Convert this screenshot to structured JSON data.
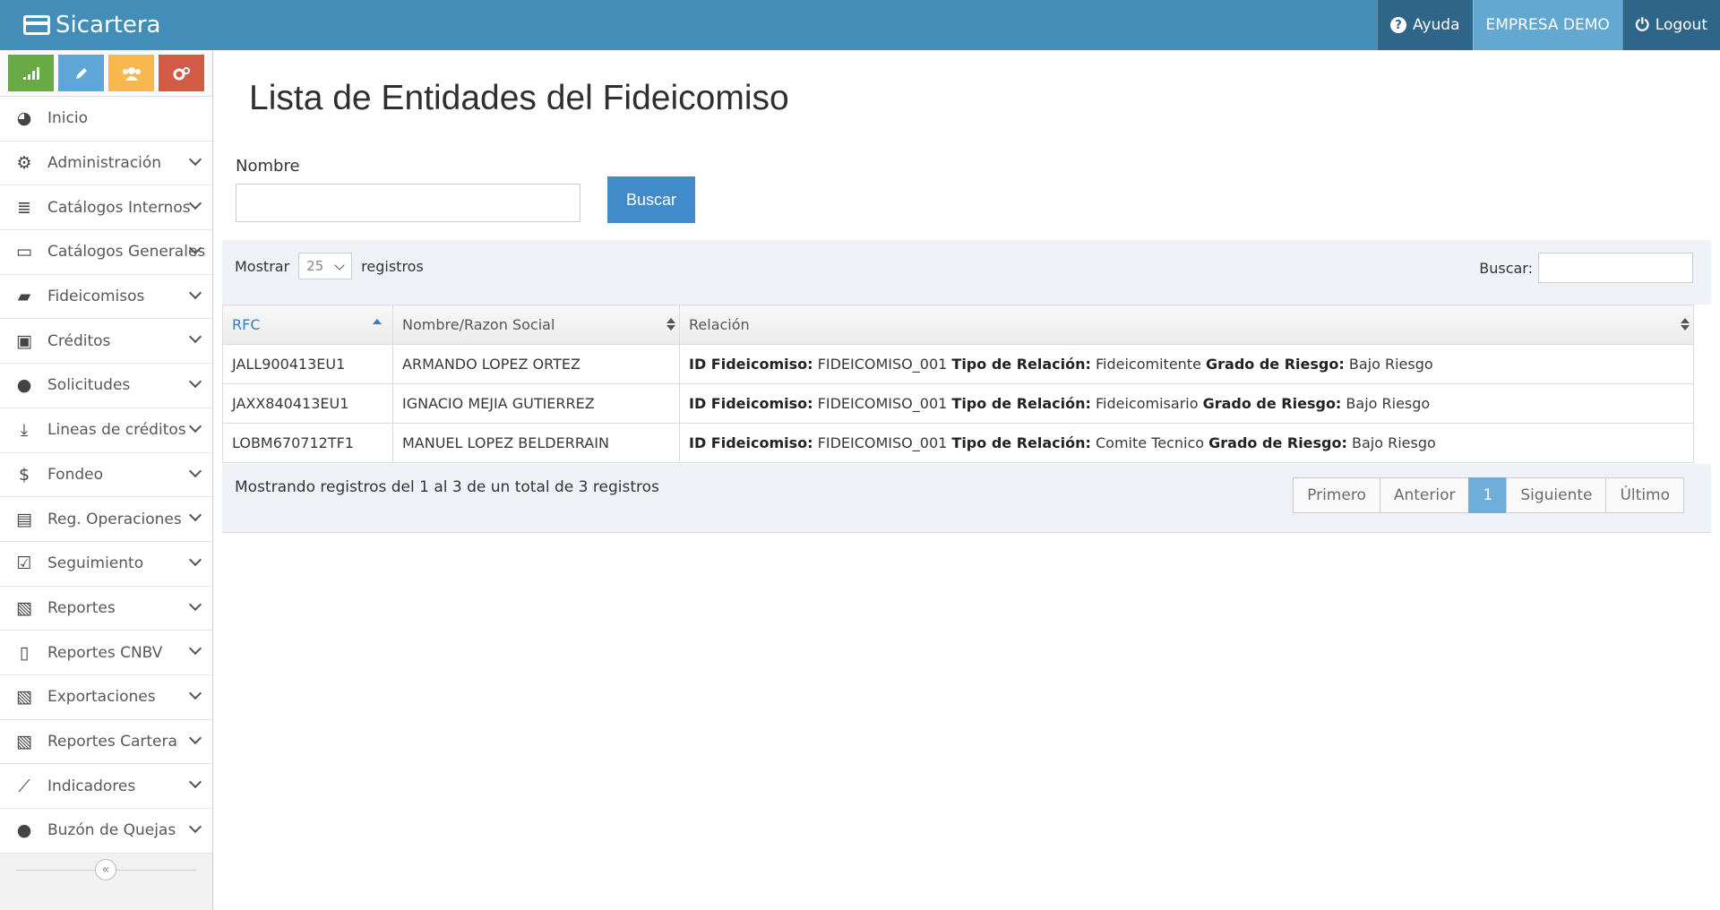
{
  "navbar": {
    "brand": "Sicartera",
    "help_label": "Ayuda",
    "company_label": "EMPRESA DEMO",
    "logout_label": "Logout"
  },
  "sidebar": {
    "shortcuts": [
      {
        "icon": "signal-icon",
        "color": "#69aa46"
      },
      {
        "icon": "pencil-icon",
        "color": "#5ea5d8"
      },
      {
        "icon": "users-icon",
        "color": "#f8b84e"
      },
      {
        "icon": "cogs-icon",
        "color": "#d15b47"
      }
    ],
    "items": [
      {
        "label": "Inicio",
        "icon": "dashboard-icon"
      },
      {
        "label": "Administración",
        "icon": "cogs-icon"
      },
      {
        "label": "Catálogos Internos",
        "icon": "database-icon"
      },
      {
        "label": "Catálogos Generales",
        "icon": "desktop-icon"
      },
      {
        "label": "Fideicomisos",
        "icon": "folder-open-icon"
      },
      {
        "label": "Créditos",
        "icon": "briefcase-icon"
      },
      {
        "label": "Solicitudes",
        "icon": "user-icon"
      },
      {
        "label": "Lineas de créditos",
        "icon": "download-icon"
      },
      {
        "label": "Fondeo",
        "icon": "dollar-icon"
      },
      {
        "label": "Reg. Operaciones",
        "icon": "file-text-icon"
      },
      {
        "label": "Seguimiento",
        "icon": "check-square-icon"
      },
      {
        "label": "Reportes",
        "icon": "file-excel-icon"
      },
      {
        "label": "Reportes CNBV",
        "icon": "file-icon"
      },
      {
        "label": "Exportaciones",
        "icon": "file-excel-icon"
      },
      {
        "label": "Reportes Cartera",
        "icon": "file-excel-icon"
      },
      {
        "label": "Indicadores",
        "icon": "line-chart-icon"
      },
      {
        "label": "Buzón de Quejas",
        "icon": "comment-icon"
      }
    ]
  },
  "main": {
    "title": "Lista de Entidades del Fideicomiso",
    "name_label": "Nombre",
    "search_button": "Buscar",
    "table_controls": {
      "show_label": "Mostrar",
      "show_value": "25",
      "records_label": "registros",
      "search_label": "Buscar:"
    },
    "columns": [
      "RFC",
      "Nombre/Razon Social",
      "Relación"
    ],
    "relation_labels": {
      "id": "ID Fideicomiso:",
      "type": "Tipo de Relación:",
      "risk": "Grado de Riesgo:"
    },
    "rows": [
      {
        "rfc": "JALL900413EU1",
        "name": "ARMANDO LOPEZ ORTEZ",
        "id": "FIDEICOMISO_001",
        "type": "Fideicomitente",
        "risk": "Bajo Riesgo"
      },
      {
        "rfc": "JAXX840413EU1",
        "name": "IGNACIO MEJIA GUTIERREZ",
        "id": "FIDEICOMISO_001",
        "type": "Fideicomisario",
        "risk": "Bajo Riesgo"
      },
      {
        "rfc": "LOBM670712TF1",
        "name": "MANUEL LOPEZ BELDERRAIN",
        "id": "FIDEICOMISO_001",
        "type": "Comite Tecnico",
        "risk": "Bajo Riesgo"
      }
    ],
    "info": "Mostrando registros del 1 al 3 de un total de 3 registros",
    "pagination": {
      "first": "Primero",
      "prev": "Anterior",
      "current": "1",
      "next": "Siguiente",
      "last": "Último"
    }
  }
}
